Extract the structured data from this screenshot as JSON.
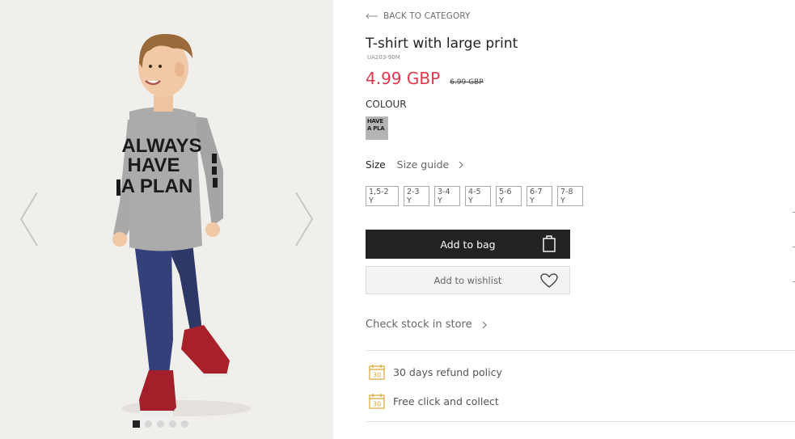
{
  "back": {
    "label": "BACK TO CATEGORY",
    "icon": "arrow-left-icon"
  },
  "product": {
    "title": "T-shirt with large print",
    "sku": "UA203-90M",
    "price": "4.99 GBP",
    "old_price": "6.99 GBP",
    "price_color": "#e0394d"
  },
  "shirt_print": {
    "line1": "ALWAYS",
    "line2": "HAVE",
    "line3": "A PLAN"
  },
  "colour": {
    "label": "COLOUR",
    "swatch_text_1": "HAVE",
    "swatch_text_2": "A PLA"
  },
  "size": {
    "label": "Size",
    "guide_label": "Size guide",
    "options": [
      "1,5-2 Y",
      "2-3 Y",
      "3-4 Y",
      "4-5 Y",
      "5-6 Y",
      "6-7 Y",
      "7-8 Y"
    ]
  },
  "actions": {
    "add_to_bag": "Add to bag",
    "add_to_wishlist": "Add to wishlist",
    "check_stock": "Check stock in store"
  },
  "benefits": [
    {
      "label": "30 days refund policy",
      "icon": "calendar-30-icon",
      "icon_text": "30"
    },
    {
      "label": "Free click and collect",
      "icon": "calendar-30-icon",
      "icon_text": "30"
    }
  ],
  "gallery": {
    "image_count": 5,
    "active_index": 0
  },
  "colors": {
    "accent_button": "#222222",
    "benefit_icon": "#d9a531"
  }
}
